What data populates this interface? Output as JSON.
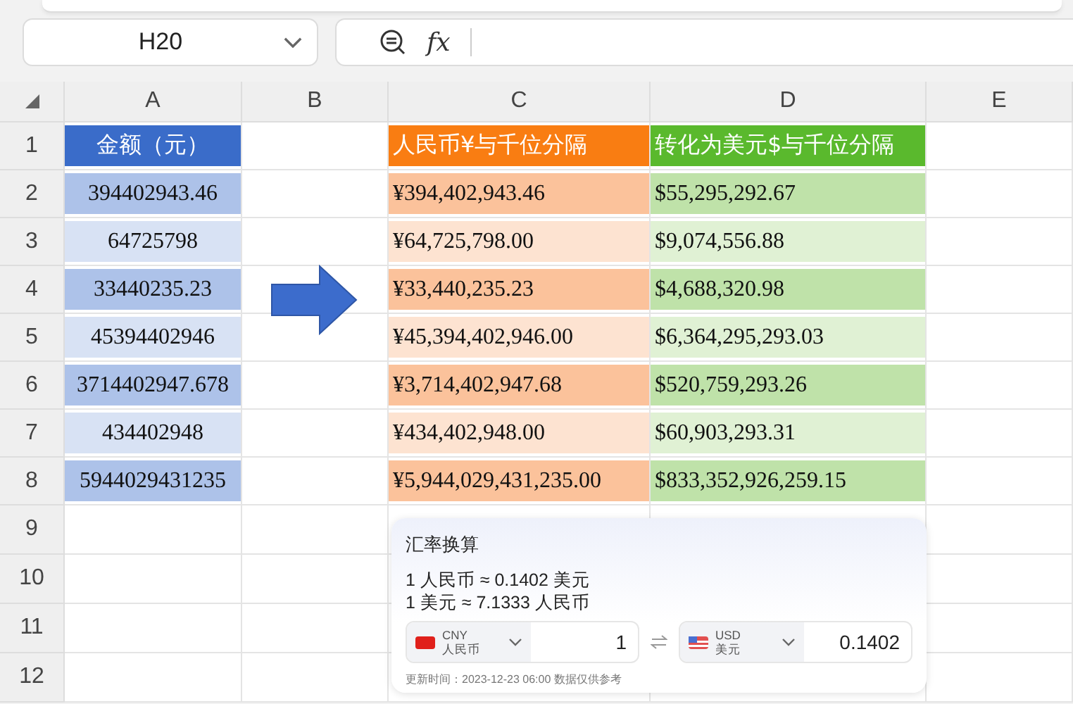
{
  "toolbar": {
    "name_box": "H20",
    "formula_label": "fx"
  },
  "columns": [
    "A",
    "B",
    "C",
    "D",
    "E"
  ],
  "rows": [
    {
      "number": "1",
      "cells": [
        "金额（元）",
        "",
        "人民币¥与千位分隔",
        "转化为美元$与千位分隔",
        ""
      ]
    },
    {
      "number": "2",
      "cells": [
        "394402943.46",
        "",
        "¥394,402,943.46",
        "$55,295,292.67",
        ""
      ]
    },
    {
      "number": "3",
      "cells": [
        "64725798",
        "",
        "¥64,725,798.00",
        "$9,074,556.88",
        ""
      ]
    },
    {
      "number": "4",
      "cells": [
        "33440235.23",
        "",
        "¥33,440,235.23",
        "$4,688,320.98",
        ""
      ]
    },
    {
      "number": "5",
      "cells": [
        "45394402946",
        "",
        "¥45,394,402,946.00",
        "$6,364,295,293.03",
        ""
      ]
    },
    {
      "number": "6",
      "cells": [
        "3714402947.678",
        "",
        "¥3,714,402,947.68",
        "$520,759,293.26",
        ""
      ]
    },
    {
      "number": "7",
      "cells": [
        "434402948",
        "",
        "¥434,402,948.00",
        "$60,903,293.31",
        ""
      ]
    },
    {
      "number": "8",
      "cells": [
        "5944029431235",
        "",
        "¥5,944,029,431,235.00",
        "$833,352,926,259.15",
        ""
      ]
    },
    {
      "number": "9",
      "cells": [
        "",
        "",
        "",
        "",
        ""
      ]
    },
    {
      "number": "10",
      "cells": [
        "",
        "",
        "",
        "",
        ""
      ]
    },
    {
      "number": "11",
      "cells": [
        "",
        "",
        "",
        "",
        ""
      ]
    },
    {
      "number": "12",
      "cells": [
        "",
        "",
        "",
        "",
        ""
      ]
    }
  ],
  "converter": {
    "title": "汇率换算",
    "rates": [
      "1 人民币 ≈ 0.1402 美元",
      "1 美元 ≈ 7.1333 人民币"
    ],
    "currencies": [
      {
        "kind": "cny",
        "code": "CNY",
        "name": "人民币",
        "value": "1"
      },
      {
        "kind": "usd",
        "code": "USD",
        "name": "美元",
        "value": "0.1402"
      }
    ],
    "footer": "更新时间：2023-12-23 06:00 数据仅供参考"
  }
}
